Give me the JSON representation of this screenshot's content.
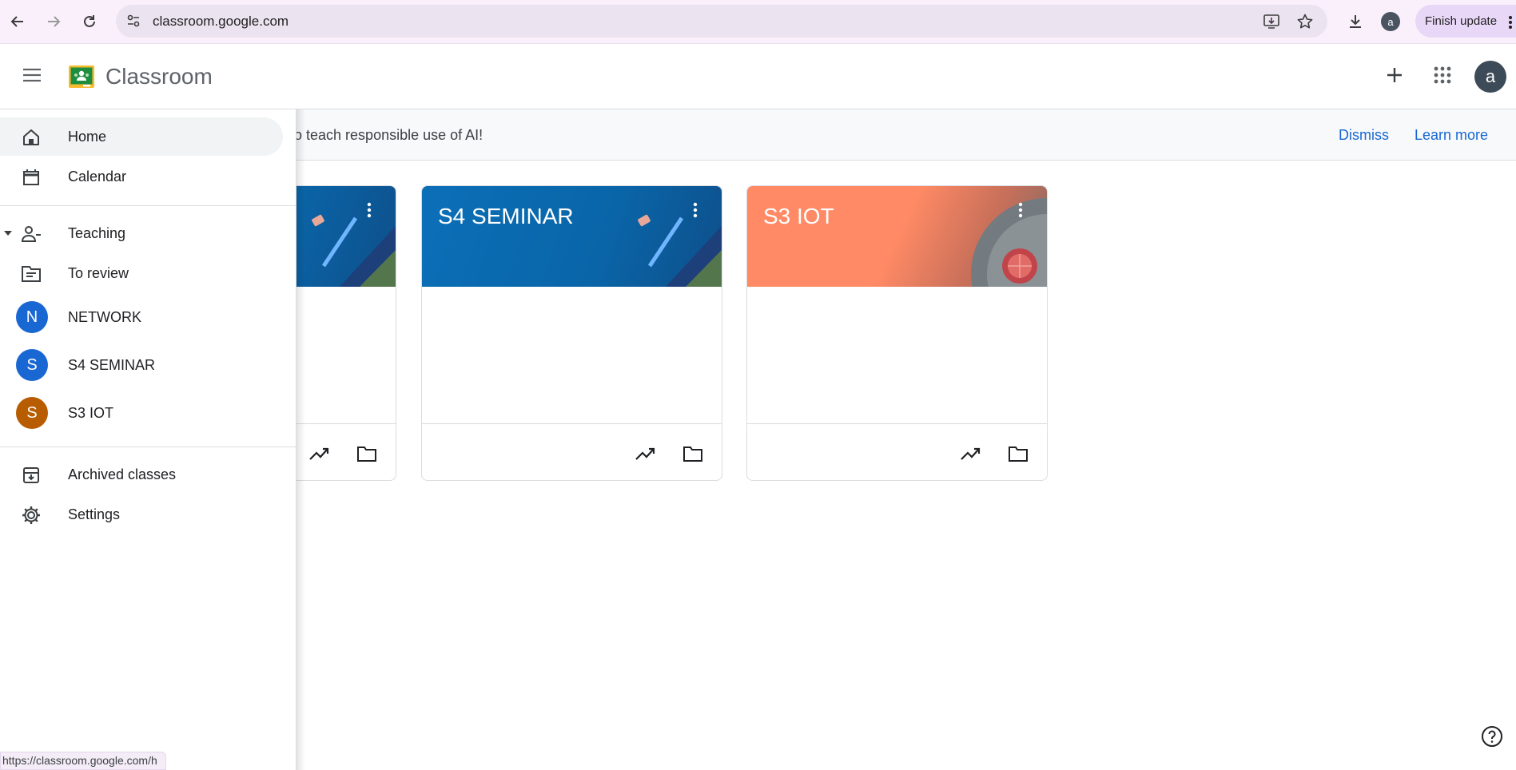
{
  "browser": {
    "url": "classroom.google.com",
    "profile_initial": "a",
    "finish_update_label": "Finish update",
    "status_url": "https://classroom.google.com/h"
  },
  "header": {
    "app_title": "Classroom",
    "avatar_initial": "a"
  },
  "banner": {
    "text": "rities to teach responsible use of AI!",
    "dismiss_label": "Dismiss",
    "learn_more_label": "Learn more"
  },
  "drawer": {
    "home_label": "Home",
    "calendar_label": "Calendar",
    "teaching_label": "Teaching",
    "to_review_label": "To review",
    "classes": [
      {
        "initial": "N",
        "name": "NETWORK",
        "color": "#1967d2"
      },
      {
        "initial": "S",
        "name": "S4 SEMINAR",
        "color": "#1967d2"
      },
      {
        "initial": "S",
        "name": "S3 IOT",
        "color": "#b85c00"
      }
    ],
    "archived_label": "Archived classes",
    "settings_label": "Settings"
  },
  "cards": [
    {
      "title": "",
      "theme": "blue"
    },
    {
      "title": "S4 SEMINAR",
      "theme": "blue"
    },
    {
      "title": "S3 IOT",
      "theme": "orange"
    }
  ],
  "colors": {
    "link_blue": "#1967d2",
    "card_blue": "#0b6fb8",
    "card_orange": "#ff8a65"
  }
}
